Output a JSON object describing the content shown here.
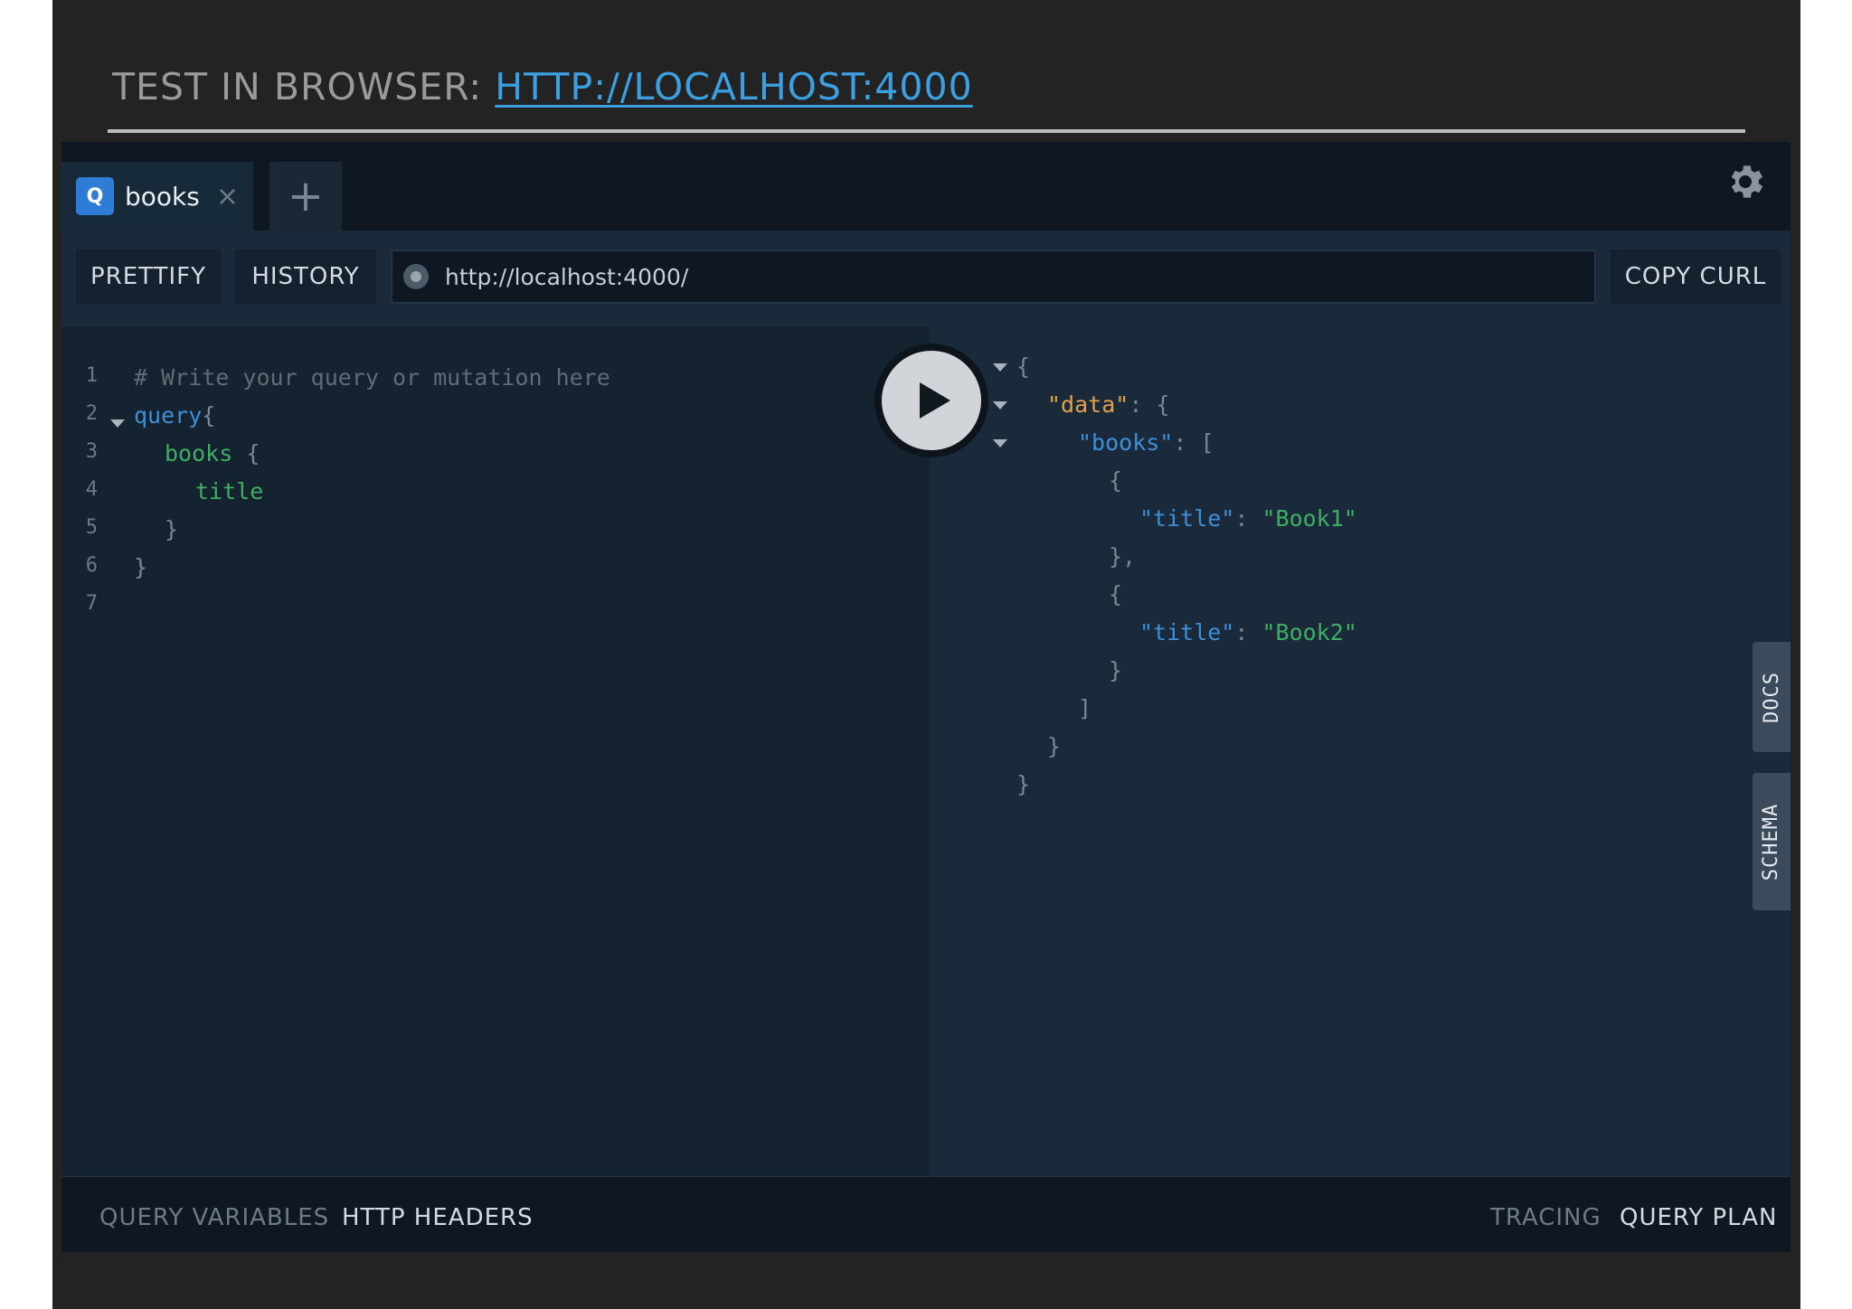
{
  "slide": {
    "heading_prefix": "TEST IN BROWSER:",
    "heading_link": "HTTP://LOCALHOST:4000"
  },
  "tabs": {
    "active": {
      "badge": "Q",
      "label": "books",
      "close": "×"
    },
    "new_tab": "+"
  },
  "toolbar": {
    "prettify": "PRETTIFY",
    "history": "HISTORY",
    "url": "http://localhost:4000/",
    "copy_curl": "COPY CURL"
  },
  "editor": {
    "line_numbers": [
      "1",
      "2",
      "3",
      "4",
      "5",
      "6",
      "7"
    ],
    "lines": [
      {
        "comment": "# Write your query or mutation here"
      },
      {
        "kw": "query",
        "punc": "{"
      },
      {
        "field": "books",
        "punc": " {"
      },
      {
        "field": "title"
      },
      {
        "punc": "}"
      },
      {
        "punc": "}"
      }
    ]
  },
  "result": {
    "open_brace": "{",
    "data_key": "\"data\"",
    "colon_brace": ": {",
    "books_key": "\"books\"",
    "colon_bracket": ": [",
    "obj_open": "{",
    "title_key": "\"title\"",
    "colon": ": ",
    "book1": "\"Book1\"",
    "obj_close_comma": "},",
    "book2": "\"Book2\"",
    "obj_close": "}",
    "array_close": "]",
    "data_close": "}",
    "root_close": "}"
  },
  "side_tabs": {
    "docs": "DOCS",
    "schema": "SCHEMA"
  },
  "bottom": {
    "query_variables": "QUERY VARIABLES",
    "http_headers": "HTTP HEADERS",
    "tracing": "TRACING",
    "query_plan": "QUERY PLAN"
  },
  "icons": {
    "settings": "gear-icon",
    "play": "play-icon",
    "new_tab": "plus-icon",
    "close": "close-icon",
    "status": "status-dot-icon",
    "fold": "fold-arrow-icon"
  },
  "colors": {
    "link": "#3b9fe0",
    "query_badge": "#2f7cd6",
    "keyword": "#3e8fd8",
    "field": "#3fae63",
    "data_key": "#e0a24b",
    "string": "#3fae63"
  }
}
